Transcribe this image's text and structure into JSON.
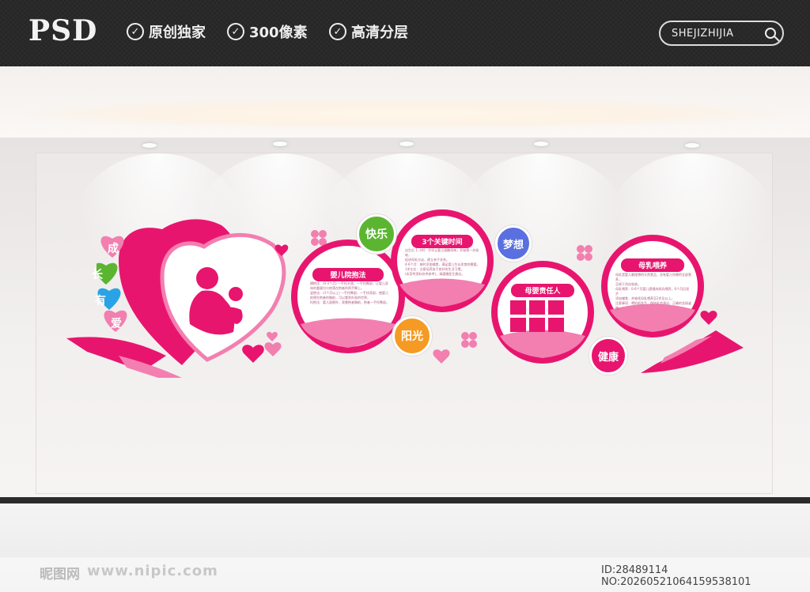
{
  "header": {
    "logo_text": "PSD",
    "features": [
      "原创独家",
      "300像素",
      "高清分层"
    ],
    "search_text": "SHEJIZHIJIA"
  },
  "wall": {
    "heart_words": [
      "成",
      "长",
      "有",
      "爱"
    ],
    "bubbles": [
      "快乐",
      "阳光",
      "梦想",
      "健康"
    ],
    "boards": [
      {
        "title": "婴儿院抱法",
        "lines": [
          "横抱法：(0-3个月) 一手托头颈，一手托臀部，让婴儿身",
          "体的重量均匀地落在抱者的两手臂上。",
          "竖抱法：(3个月以上) 一手托臀部，一手扶背部，使婴儿",
          "依偎在抱者的胸前，可以看到外面的世界。",
          "托抱法：婴儿面朝外，背靠抱者胸前，抱者一手托臀部。"
        ]
      },
      {
        "title": "3个关键时间",
        "lines": [
          "出生后 1 小时：尽早让婴儿接触母亲，开始第一次吸吮，",
          "促进母乳分泌，建立亲子关系。",
          "4-6个月：按时添加辅食，满足婴儿生长发育的需要。",
          "1岁左右：注意培养孩子良好的生活习惯。",
          "(本宣传资料仅供参考)，请遵循医生建议。"
        ]
      },
      {
        "title": "母婴责任人",
        "lines": []
      },
      {
        "title": "母乳喂养",
        "lines": [
          "母乳是婴儿最理想的天然食品，含有婴儿所需的全部营养，",
          "且易于消化吸收。",
          "母乳喂养：0-6个月婴儿提倡纯母乳喂养，6个月后逐步",
          "添加辅食，并继续母乳喂养至2岁及以上。",
          "注意事项：喂奶前洗手，保持乳房清洁，正确的含接姿势。"
        ]
      }
    ]
  },
  "footer": {
    "logo_text": "昵图网",
    "url_text": "www.nipic.com",
    "id_text": "ID:28489114 NO:20260521064159538101"
  },
  "colors": {
    "pink": "#e8156f",
    "light_pink": "#f27fb0",
    "green": "#5bb531",
    "orange": "#f59a23",
    "blue": "#2aa3e6",
    "purple_blue": "#5a6fe0"
  }
}
